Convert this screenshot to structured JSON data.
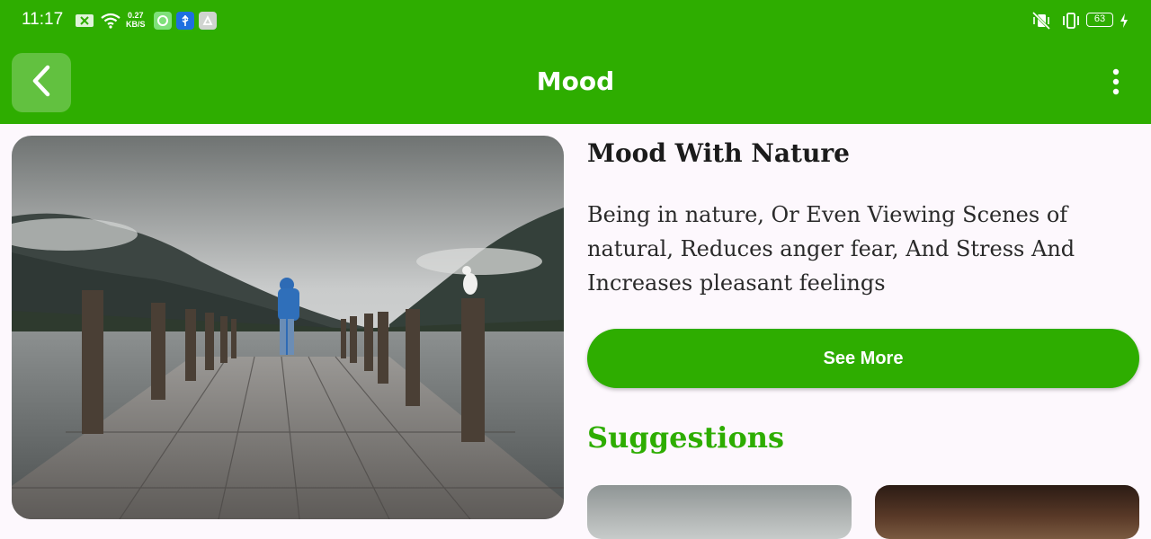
{
  "status_bar": {
    "time": "11:17",
    "net_speed_value": "0.27",
    "net_speed_unit": "KB/S",
    "battery_level": "63",
    "icons": [
      "notification-x-icon",
      "wifi-icon",
      "app-icon-1",
      "usb-icon",
      "drive-icon",
      "vibrate-off-icon",
      "vibrate-icon",
      "battery-icon",
      "charging-icon"
    ]
  },
  "app_bar": {
    "title": "Mood",
    "back_icon": "chevron-left-icon",
    "menu_icon": "more-vertical-icon",
    "color": "#2ead00"
  },
  "content": {
    "hero_image": "lake-pier-person-seagull",
    "heading": "Mood With Nature",
    "description": "Being in nature, Or Even Viewing Scenes of natural, Reduces anger fear, And Stress And Increases pleasant feelings",
    "button_label": "See More",
    "suggestions_title": "Suggestions",
    "suggestions": [
      {
        "image": "cloudy-landscape"
      },
      {
        "image": "warm-sunset"
      }
    ]
  }
}
